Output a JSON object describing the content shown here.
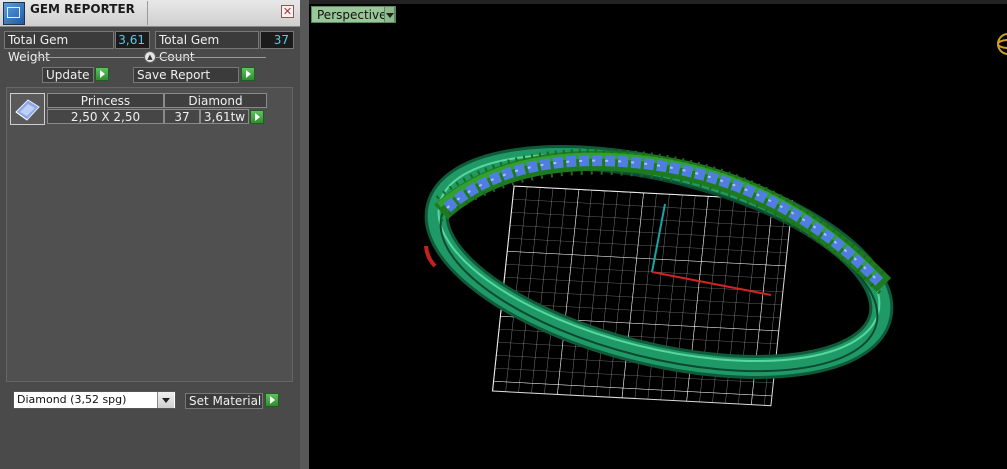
{
  "panel": {
    "title": "GEM REPORTER",
    "close_icon": "close-icon",
    "app_icon": "gem-reporter-icon",
    "total_gem_weight_label": "Total Gem Weight",
    "total_gem_weight_value": "3,61",
    "total_gem_count_label": "Total Gem Count",
    "total_gem_count_value": "37",
    "update_label": "Update",
    "save_report_label": "Save Report",
    "gem_rows": [
      {
        "shape": "Princess",
        "material": "Diamond",
        "size": "2,50 X 2,50",
        "count": "37",
        "weight": "3,61tw"
      }
    ],
    "material_select_value": "Diamond      (3,52 spg)",
    "set_material_label": "Set Material"
  },
  "viewport": {
    "view_label": "Perspective",
    "colors": {
      "background": "#000000",
      "grid": "#cfcfcf",
      "ring_band": "#1a8a5a",
      "gems": "#4f7ee0",
      "prongs": "#1e7a1e",
      "x_axis": "#d32222",
      "y_axis": "#16a6a6"
    }
  }
}
